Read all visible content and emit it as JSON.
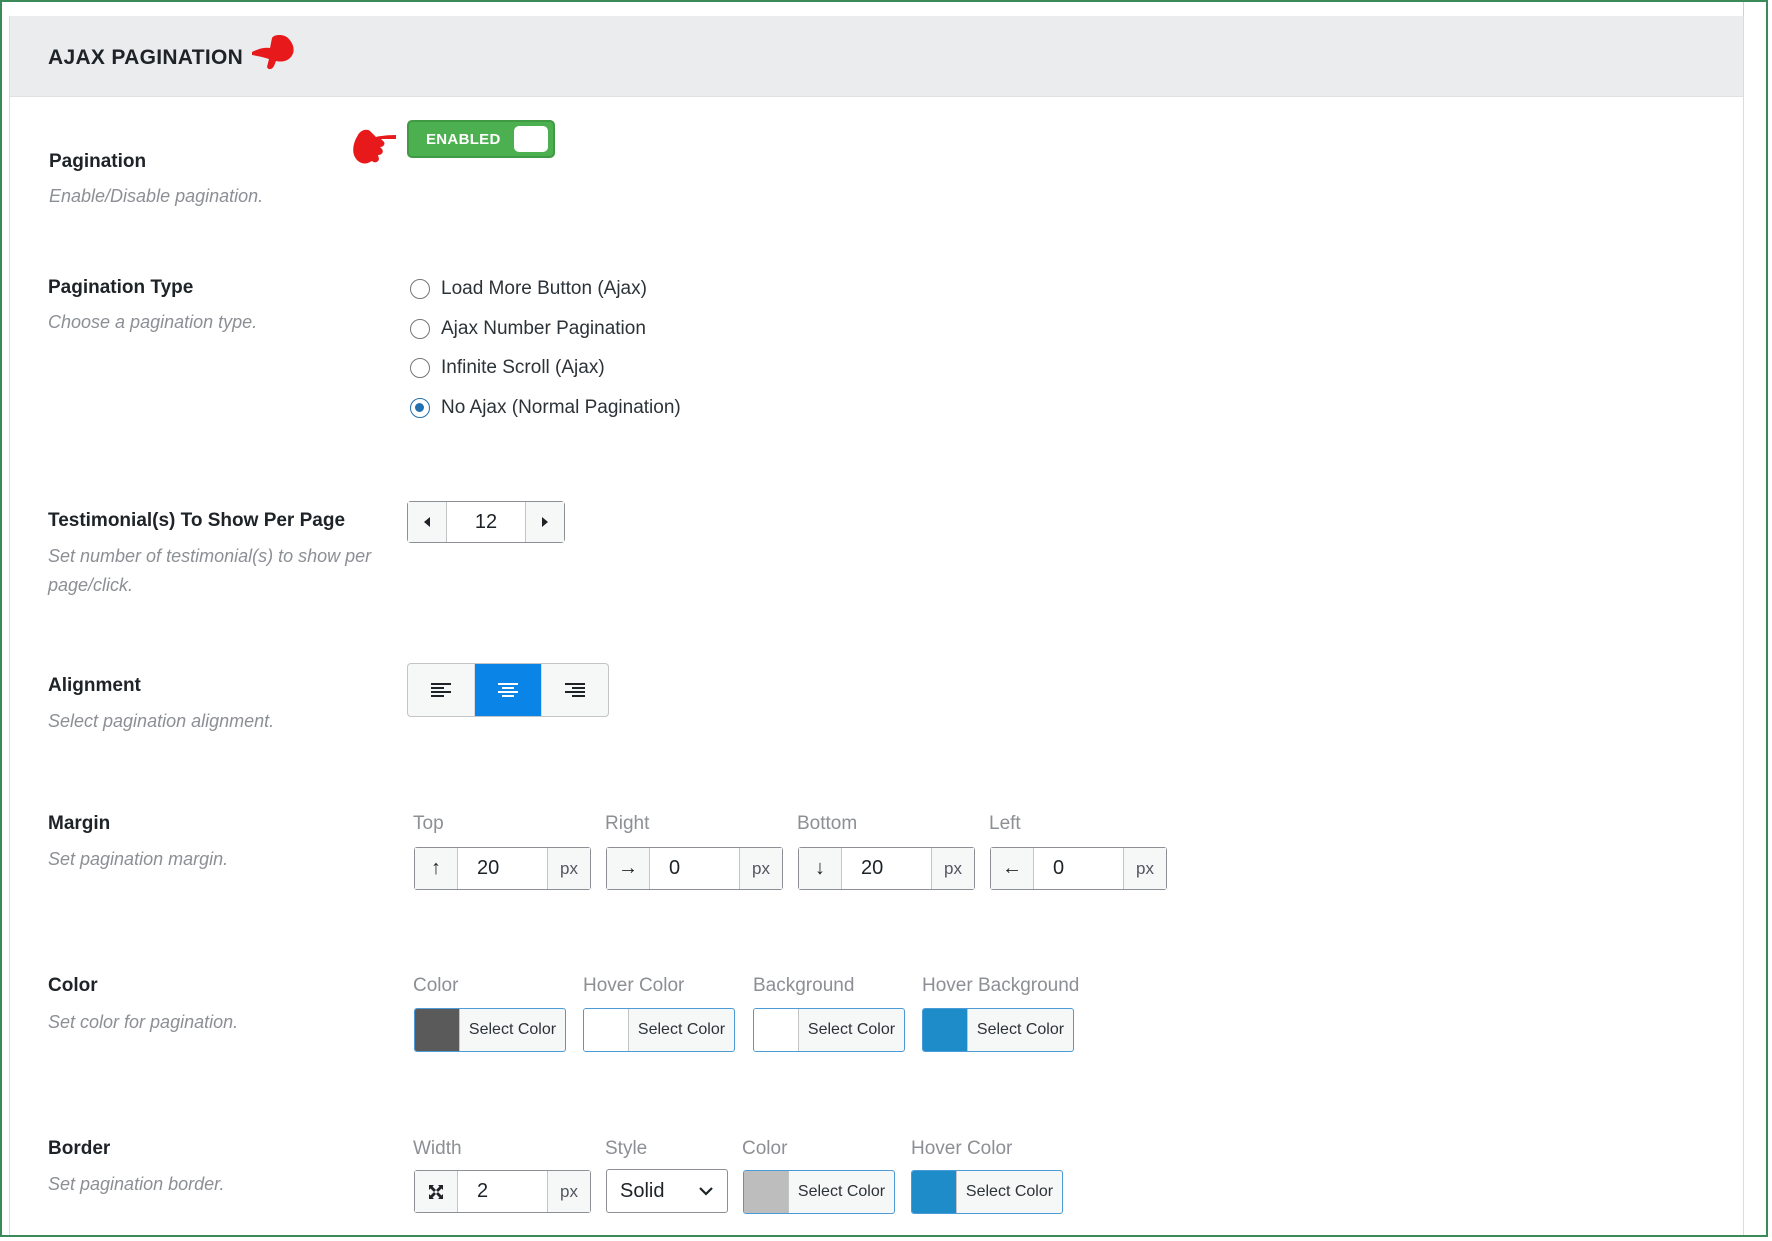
{
  "section": {
    "title": "AJAX PAGINATION"
  },
  "pagination": {
    "label": "Pagination",
    "desc": "Enable/Disable pagination.",
    "toggle_label": "ENABLED",
    "enabled": true
  },
  "pagination_type": {
    "label": "Pagination Type",
    "desc": "Choose a pagination type.",
    "options": [
      {
        "label": "Load More Button (Ajax)",
        "checked": false
      },
      {
        "label": "Ajax Number Pagination",
        "checked": false
      },
      {
        "label": "Infinite Scroll (Ajax)",
        "checked": false
      },
      {
        "label": "No Ajax (Normal Pagination)",
        "checked": true
      }
    ]
  },
  "per_page": {
    "label": "Testimonial(s) To Show Per Page",
    "desc": "Set number of testimonial(s) to show per page/click.",
    "value": "12"
  },
  "alignment": {
    "label": "Alignment",
    "desc": "Select pagination alignment.",
    "options": [
      "left",
      "center",
      "right"
    ],
    "selected": "center"
  },
  "margin": {
    "label": "Margin",
    "desc": "Set pagination margin.",
    "fields": [
      {
        "label": "Top",
        "value": "20",
        "unit": "px",
        "icon": "arrow-up-icon"
      },
      {
        "label": "Right",
        "value": "0",
        "unit": "px",
        "icon": "arrow-right-icon"
      },
      {
        "label": "Bottom",
        "value": "20",
        "unit": "px",
        "icon": "arrow-down-icon"
      },
      {
        "label": "Left",
        "value": "0",
        "unit": "px",
        "icon": "arrow-left-icon"
      }
    ]
  },
  "color": {
    "label": "Color",
    "desc": "Set color for pagination.",
    "fields": [
      {
        "label": "Color",
        "button": "Select Color",
        "swatch": "#5a5a5a"
      },
      {
        "label": "Hover Color",
        "button": "Select Color",
        "swatch": "#ffffff"
      },
      {
        "label": "Background",
        "button": "Select Color",
        "swatch": "#ffffff"
      },
      {
        "label": "Hover Background",
        "button": "Select Color",
        "swatch": "#1e8cc8"
      }
    ]
  },
  "border": {
    "label": "Border",
    "desc": "Set pagination border.",
    "width_label": "Width",
    "width_value": "2",
    "width_unit": "px",
    "style_label": "Style",
    "style_value": "Solid",
    "color_label": "Color",
    "color_button": "Select Color",
    "color_swatch": "#bdbdbd",
    "hover_label": "Hover Color",
    "hover_button": "Select Color",
    "hover_swatch": "#1e8cc8"
  }
}
